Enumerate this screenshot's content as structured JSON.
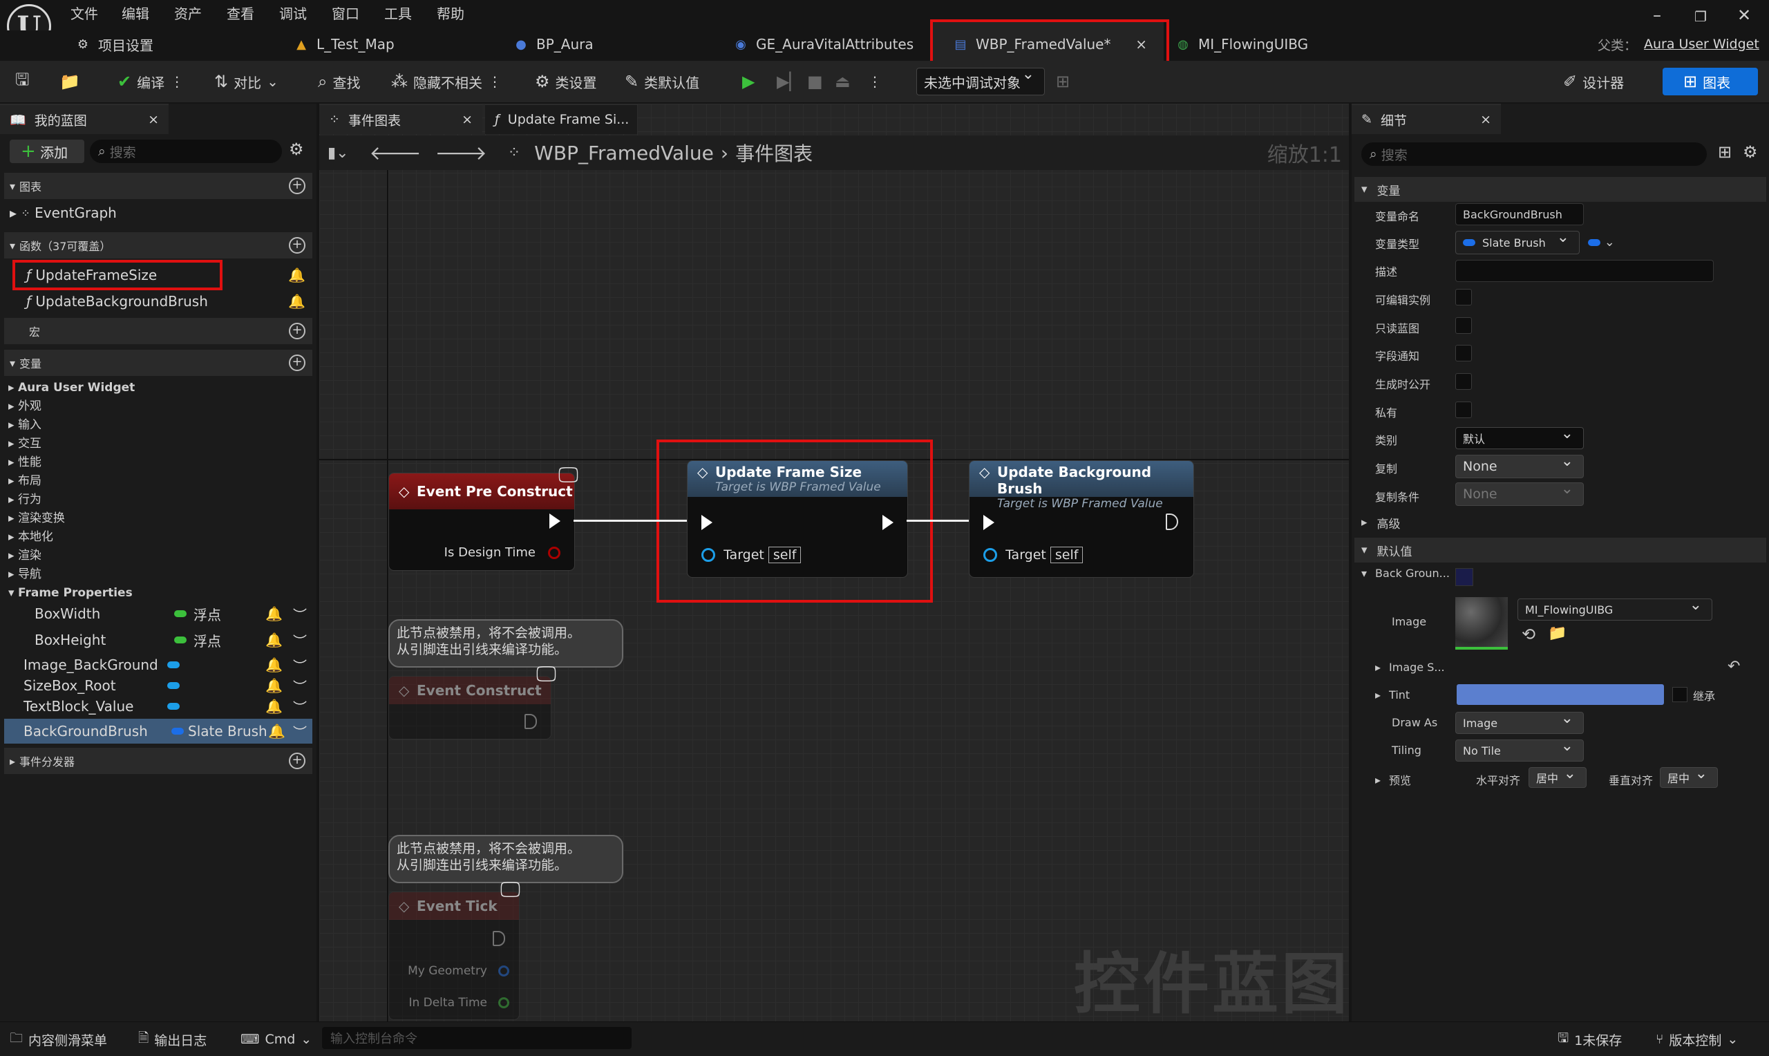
{
  "menu": [
    "文件",
    "编辑",
    "资产",
    "查看",
    "调试",
    "窗口",
    "工具",
    "帮助"
  ],
  "tabs": [
    {
      "label": "项目设置",
      "icon": "gear-icon"
    },
    {
      "label": "L_Test_Map",
      "icon": "level-icon"
    },
    {
      "label": "BP_Aura",
      "icon": "character-icon"
    },
    {
      "label": "GE_AuraVitalAttributes",
      "icon": "effect-icon"
    },
    {
      "label": "WBP_FramedValue*",
      "icon": "widget-blueprint-icon",
      "close": "×"
    },
    {
      "label": "MI_FlowingUIBG",
      "icon": "material-instance-icon"
    }
  ],
  "parent_class": {
    "label": "父类：",
    "value": "Aura User Widget"
  },
  "toolbar": {
    "compile": "编译",
    "diff": "对比",
    "find": "查找",
    "hide_unrelated": "隐藏不相关",
    "class_settings": "类设置",
    "class_defaults": "类默认值",
    "debug_target": "未选中调试对象",
    "designer": "设计器",
    "graph": "图表"
  },
  "left": {
    "tab": "我的蓝图",
    "add": "添加",
    "search_placeholder": "搜索",
    "sections": {
      "graphs": "图表",
      "functions": "函数（37可覆盖）",
      "macros": "宏",
      "variables": "变量",
      "dispatchers": "事件分发器"
    },
    "event_graph": "EventGraph",
    "functions": [
      "UpdateFrameSize",
      "UpdateBackgroundBrush"
    ],
    "var_categories": [
      "Aura User Widget",
      "外观",
      "输入",
      "交互",
      "性能",
      "布局",
      "行为",
      "渲染变换",
      "本地化",
      "渲染",
      "导航"
    ],
    "frame_properties": "Frame Properties",
    "frame_vars": [
      {
        "name": "BoxWidth",
        "type": "浮点"
      },
      {
        "name": "BoxHeight",
        "type": "浮点"
      }
    ],
    "other_vars": [
      "Image_BackGround",
      "SizeBox_Root",
      "TextBlock_Value"
    ],
    "selected_var": {
      "name": "BackGroundBrush",
      "type": "Slate Brush"
    }
  },
  "graph": {
    "tab": "事件图表",
    "tab2": "Update Frame Si...",
    "breadcrumb_asset": "WBP_FramedValue",
    "breadcrumb_graph": "事件图表",
    "zoom": "缩放1:1",
    "watermark": "控件蓝图",
    "nodes": {
      "pre_construct": {
        "title": "Event Pre Construct",
        "pin": "Is Design Time"
      },
      "update_frame": {
        "title": "Update Frame Size",
        "subtitle": "Target is WBP Framed Value",
        "target": "Target",
        "self": "self"
      },
      "update_bg": {
        "title": "Update Background Brush",
        "subtitle": "Target is WBP Framed Value",
        "target": "Target",
        "self": "self"
      },
      "construct": {
        "title": "Event Construct"
      },
      "tick": {
        "title": "Event Tick",
        "pins": [
          "My Geometry",
          "In Delta Time"
        ]
      }
    },
    "disabled_comment": "此节点被禁用，将不会被调用。\n从引脚连出引线来编译功能。"
  },
  "details": {
    "tab": "细节",
    "search_placeholder": "搜索",
    "variable_section": "变量",
    "rows": {
      "var_name": {
        "label": "变量命名",
        "value": "BackGroundBrush"
      },
      "var_type": {
        "label": "变量类型",
        "value": "Slate Brush"
      },
      "desc": {
        "label": "描述"
      },
      "instance_editable": {
        "label": "可编辑实例"
      },
      "readonly_bp": {
        "label": "只读蓝图"
      },
      "field_notify": {
        "label": "字段通知"
      },
      "expose_spawn": {
        "label": "生成时公开"
      },
      "private": {
        "label": "私有"
      },
      "category": {
        "label": "类别",
        "value": "默认"
      },
      "replication": {
        "label": "复制",
        "value": "None"
      },
      "rep_condition": {
        "label": "复制条件",
        "value": "None"
      }
    },
    "advanced": "高级",
    "default_section": "默认值",
    "brush_label": "Back Groun...",
    "image": {
      "label": "Image",
      "value": "MI_FlowingUIBG"
    },
    "image_size": "Image S...",
    "tint": {
      "label": "Tint",
      "inherit": "继承",
      "color": "#5b7fcf"
    },
    "draw_as": {
      "label": "Draw As",
      "value": "Image"
    },
    "tiling": {
      "label": "Tiling",
      "value": "No Tile"
    },
    "preview": {
      "label": "预览",
      "h_align_label": "水平对齐",
      "h_align": "居中",
      "v_align_label": "垂直对齐",
      "v_align": "居中"
    }
  },
  "status": {
    "content_drawer": "内容侧滑菜单",
    "output_log": "输出日志",
    "cmd": "Cmd",
    "cmd_placeholder": "输入控制台命令",
    "unsaved": "1未保存",
    "source_control": "版本控制"
  }
}
